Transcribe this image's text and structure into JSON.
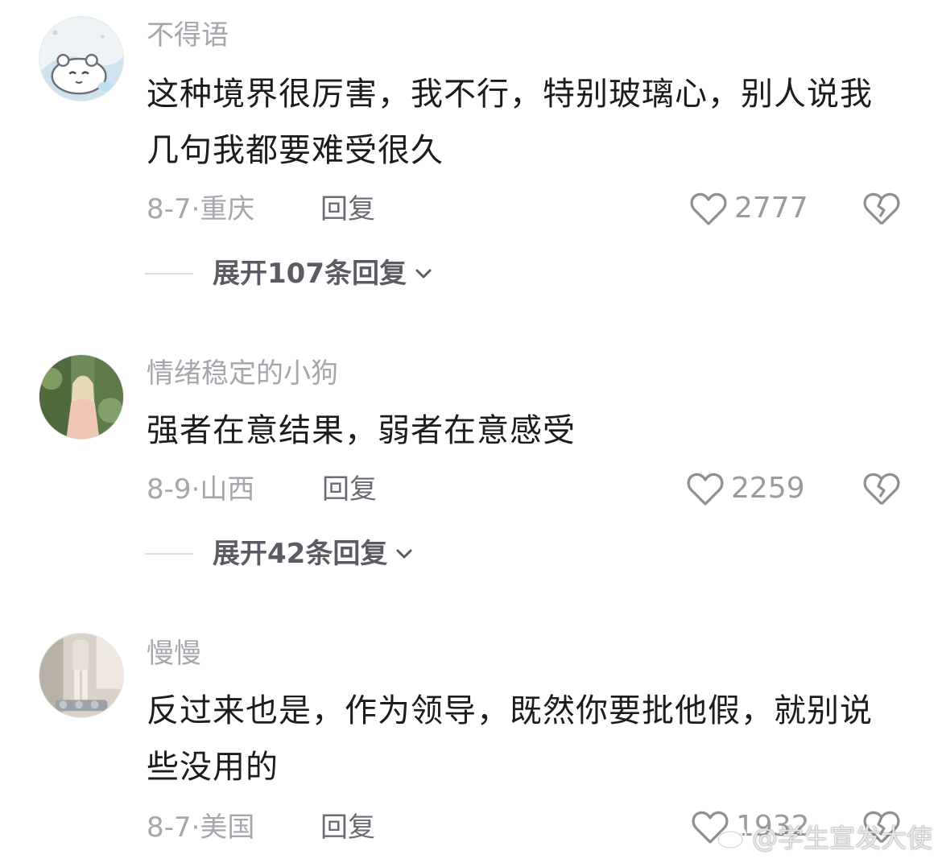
{
  "comments": [
    {
      "username": "不得语",
      "text": "这种境界很厉害，我不行，特别玻璃心，别人说我几句我都要难受很久",
      "date": "8-7",
      "location": "重庆",
      "reply_label": "回复",
      "likes": "2777",
      "expand_label": "展开107条回复"
    },
    {
      "username": "情绪稳定的小狗",
      "text": "强者在意结果，弱者在意感受",
      "date": "8-9",
      "location": "山西",
      "reply_label": "回复",
      "likes": "2259",
      "expand_label": "展开42条回复"
    },
    {
      "username": "慢慢",
      "text": "反过来也是，作为领导，既然你要批他假，就别说些没用的",
      "date": "8-7",
      "location": "美国",
      "reply_label": "回复",
      "likes": "1932"
    }
  ],
  "meta_separator": "·",
  "icons": {
    "like": "heart-outline-icon",
    "dislike": "broken-heart-icon",
    "expand": "chevron-down-icon"
  },
  "watermark": {
    "text": "@学生宣发大使",
    "logo": "weibo-logo-icon"
  }
}
